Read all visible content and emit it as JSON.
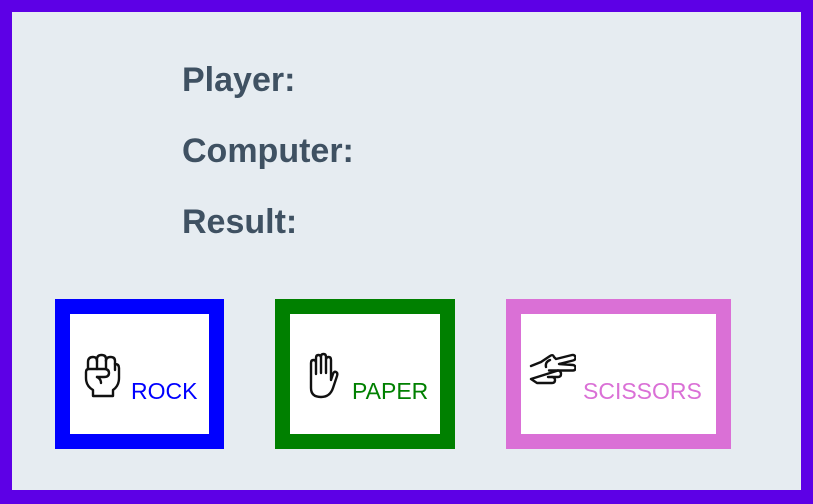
{
  "status": {
    "player_label": "Player:",
    "player_value": "",
    "computer_label": "Computer:",
    "computer_value": "",
    "result_label": "Result:",
    "result_value": ""
  },
  "choices": [
    {
      "label": "ROCK",
      "icon": "fist-icon",
      "color": "#0000ff"
    },
    {
      "label": "PAPER",
      "icon": "raised-hand-icon",
      "color": "#008000"
    },
    {
      "label": "SCISSORS",
      "icon": "victory-hand-icon",
      "color": "#da70d6"
    }
  ],
  "colors": {
    "frame": "#5d00e6",
    "panel": "#e6ecf1",
    "status_text": "#3f5162"
  }
}
